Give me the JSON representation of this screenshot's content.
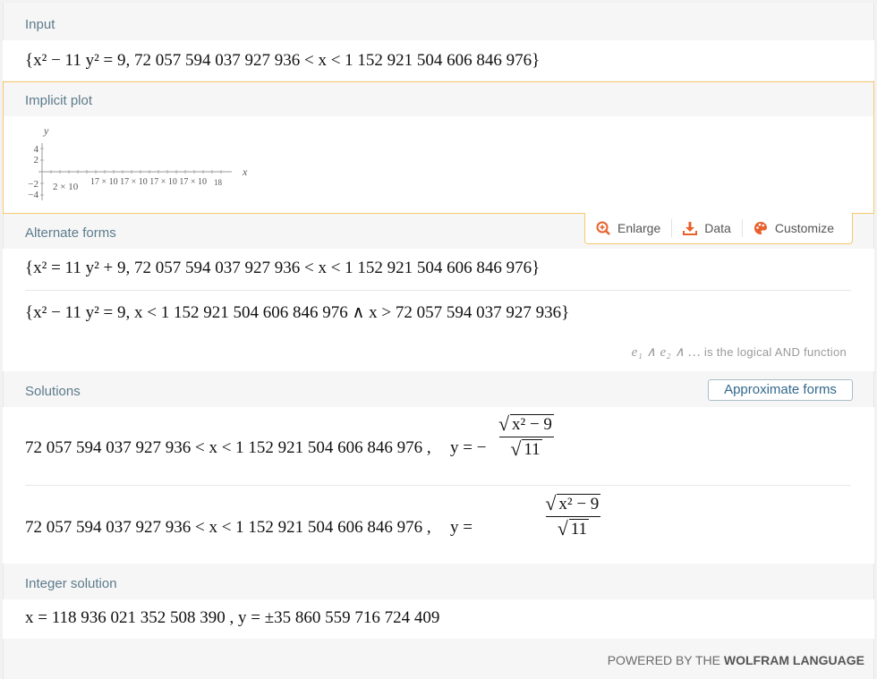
{
  "pods": {
    "input": {
      "title": "Input",
      "expr": "{x² − 11 y² = 9, 72 057 594 037 927 936 < x < 1 152 921 504 606 846 976}"
    },
    "implicit_plot": {
      "title": "Implicit plot",
      "y_axis_label": "y",
      "x_axis_label": "x",
      "y_ticks": [
        "4",
        "2",
        "−2",
        "−4"
      ],
      "x_tick_text": "2 × 10",
      "x_tick_overlap": "17 × 10 17 × 10 17 × 10 17 × 10",
      "x_last_tick": "18",
      "toolbar": {
        "enlarge": "Enlarge",
        "data": "Data",
        "customize": "Customize"
      }
    },
    "alternate_forms": {
      "title": "Alternate forms",
      "row1": "{x² = 11 y² + 9, 72 057 594 037 927 936 < x < 1 152 921 504 606 846 976}",
      "row2": "{x² − 11 y² = 9, x < 1 152 921 504 606 846 976 ∧ x > 72 057 594 037 927 936}",
      "note_rest": "is the logical AND function",
      "note_sym": "e₁ ∧ e₂ ∧ …"
    },
    "solutions": {
      "title": "Solutions",
      "button": "Approximate forms",
      "row1_range": "72 057 594 037 927 936 < x < 1 152 921 504 606 846 976 ,",
      "row1_y": "y = −",
      "row2_range": "72 057 594 037 927 936 < x < 1 152 921 504 606 846 976 ,",
      "row2_y": "y =",
      "numerator": "x² − 9",
      "denominator": "11"
    },
    "integer_solution": {
      "title": "Integer solution",
      "expr": "x = 118 936 021 352 508 390 ,   y = ±35 860 559 716 724 409"
    }
  },
  "footer": {
    "prefix": "POWERED BY THE",
    "brand": "WOLFRAM LANGUAGE"
  },
  "colors": {
    "header_text": "#5c7b8c",
    "highlight_border": "#f6c86b",
    "icon_orange": "#e8612c",
    "button_text": "#33688c"
  }
}
